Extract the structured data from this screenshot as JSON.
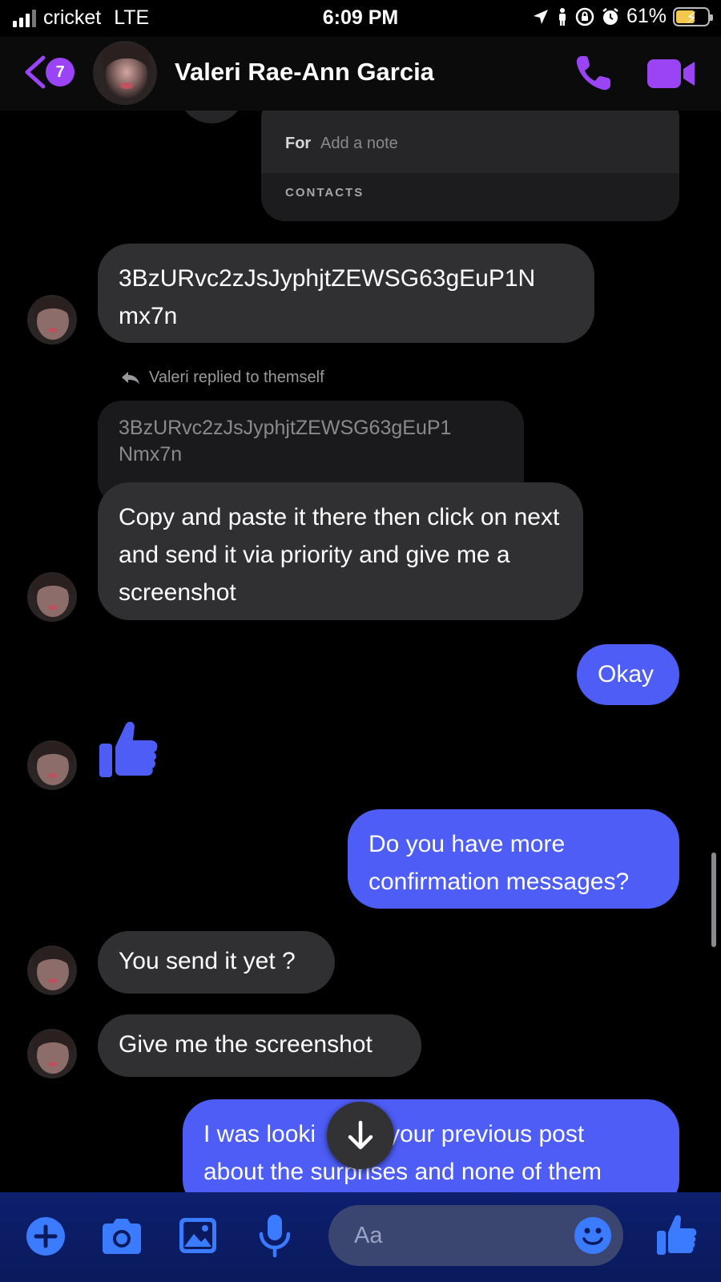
{
  "status_bar": {
    "carrier": "cricket",
    "network": "LTE",
    "time": "6:09 PM",
    "battery_percent": "61%",
    "battery_level": 0.61
  },
  "header": {
    "back_badge_count": "7",
    "contact_name": "Valeri Rae-Ann Garcia",
    "accent_color": "#9b44f5"
  },
  "payment_card": {
    "for_label": "For",
    "note_placeholder": "Add a note",
    "contacts_label": "CONTACTS"
  },
  "messages": [
    {
      "direction": "incoming",
      "text": "3BzURvc2zJsJyphjtZEWSG63gEuP1N mx7n"
    },
    {
      "direction": "incoming",
      "reply_header": "Valeri replied to themself",
      "quoted_text": "3BzURvc2zJsJyphjtZEWSG63gEuP1 Nmx7n",
      "text": "Copy and paste it there then click on next and send it via priority and give me a screenshot"
    },
    {
      "direction": "outgoing",
      "text": "Okay"
    },
    {
      "direction": "incoming",
      "type": "thumbs-up"
    },
    {
      "direction": "outgoing",
      "text": "Do you have more confirmation messages?"
    },
    {
      "direction": "incoming",
      "text": "You send it yet ?"
    },
    {
      "direction": "incoming",
      "text": "Give me the screenshot"
    },
    {
      "direction": "outgoing",
      "text": "I was looki[ng at] your previous post about the surprises and none of them",
      "visible_line_1": "I was looki",
      "visible_line_1b": "your previous post",
      "visible_line_2": "about the surprises and none of them"
    }
  ],
  "composer": {
    "placeholder": "Aa",
    "outgoing_color": "#4d5df5",
    "icon_color": "#3b7bff"
  }
}
